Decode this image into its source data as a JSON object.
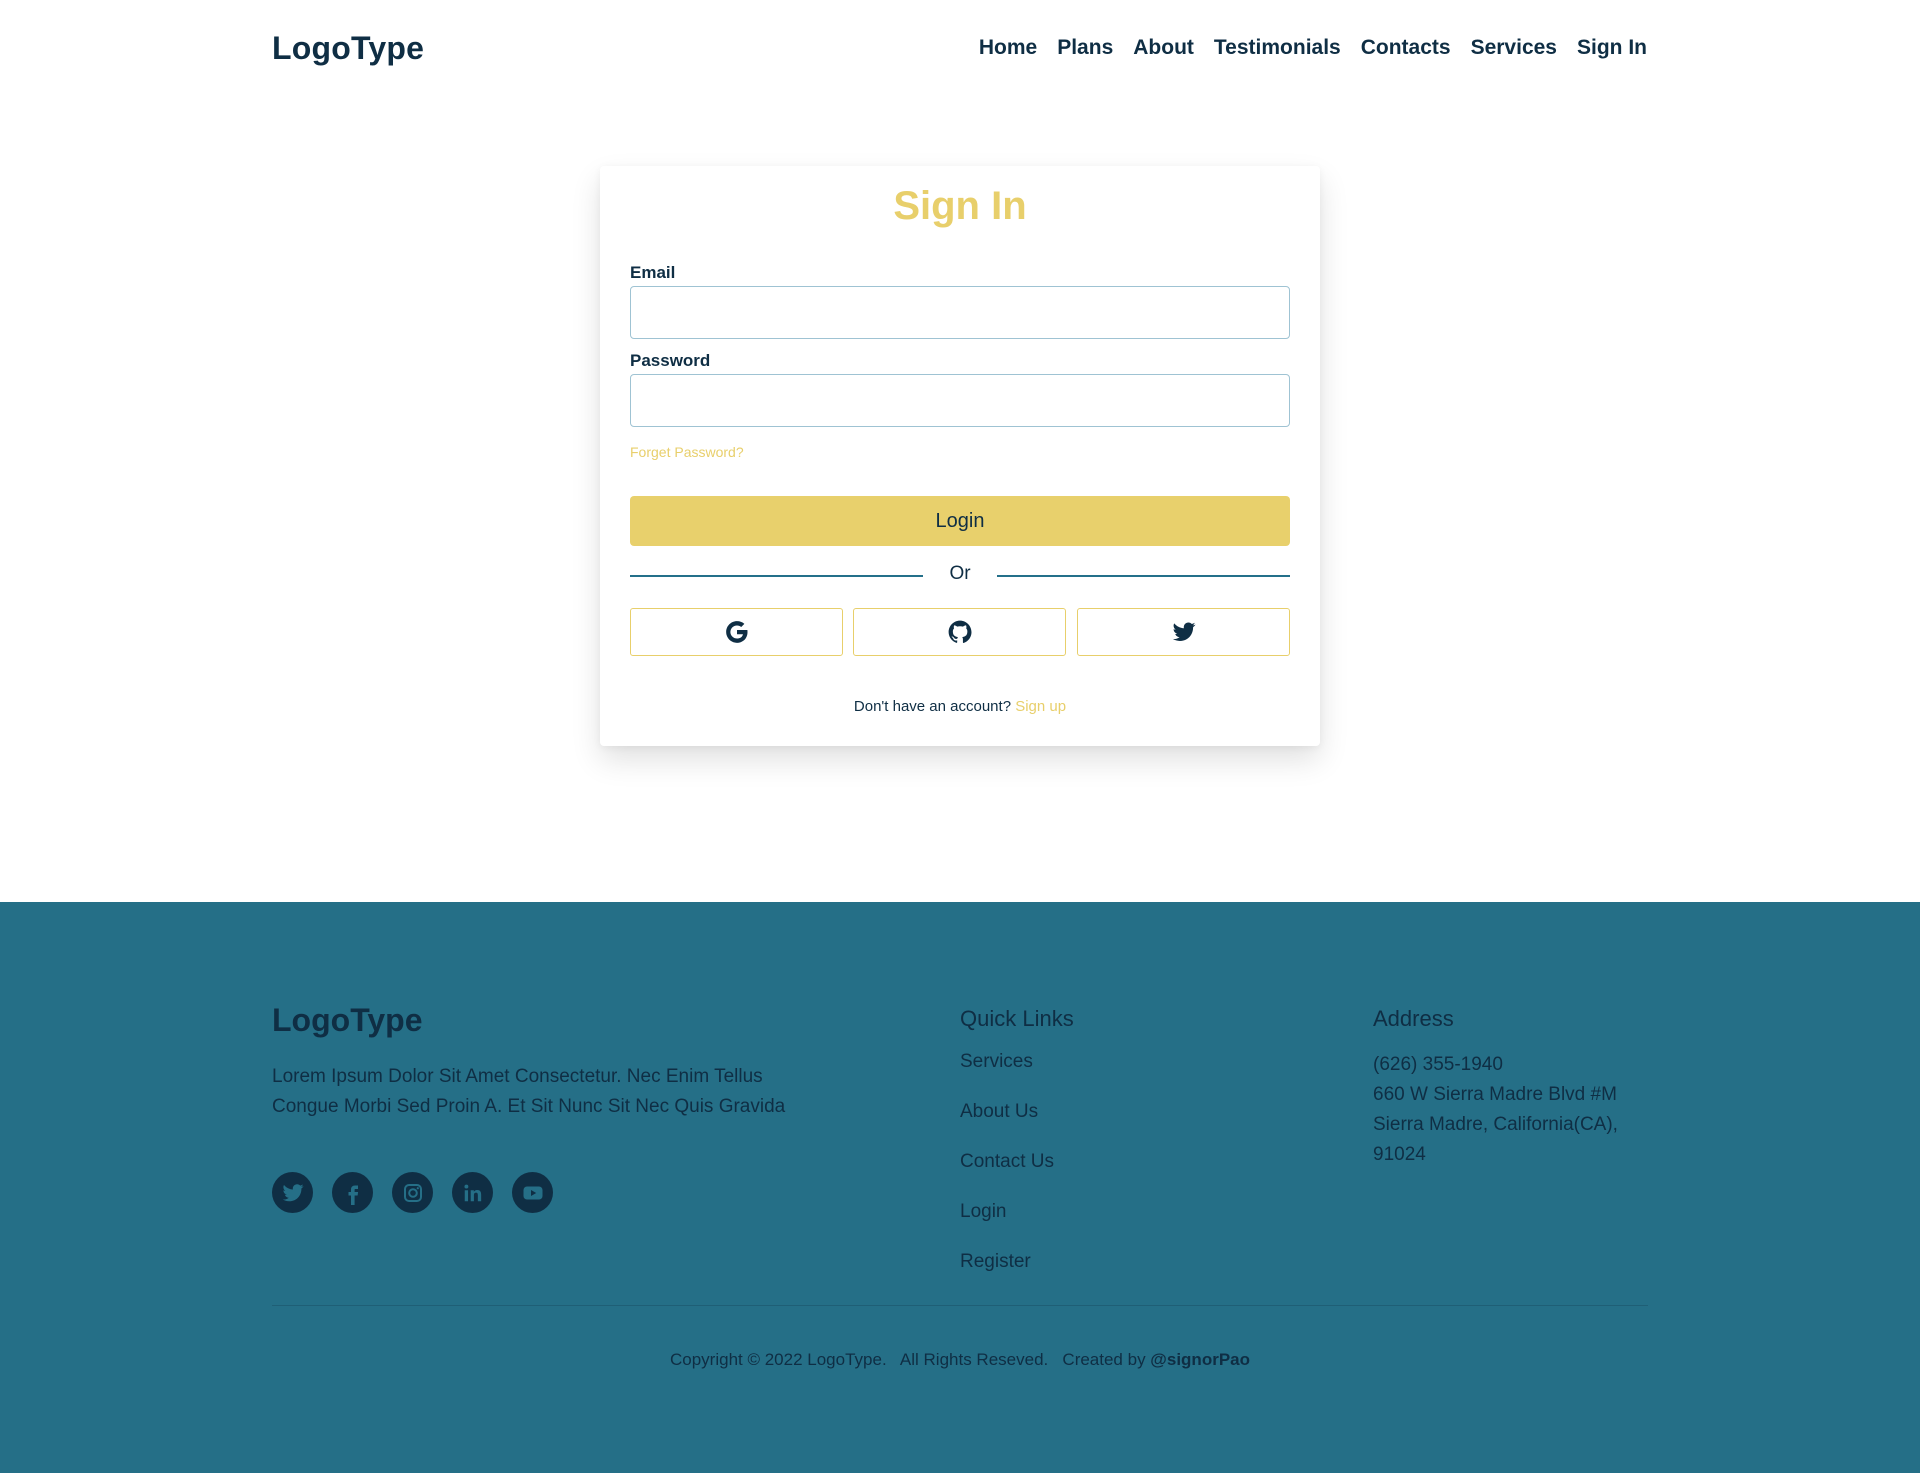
{
  "header": {
    "logo": "LogoType",
    "nav": [
      "Home",
      "Plans",
      "About",
      "Testimonials",
      "Contacts",
      "Services",
      "Sign In"
    ]
  },
  "signin": {
    "title": "Sign In",
    "email_label": "Email",
    "email_value": "",
    "password_label": "Password",
    "password_value": "",
    "forget_link": "Forget Password?",
    "login_button": "Login",
    "or_text": "Or",
    "social_buttons": [
      "google-icon",
      "github-icon",
      "twitter-icon"
    ],
    "no_account_text": "Don't have an account?",
    "signup_link": "Sign up"
  },
  "footer": {
    "logo": "LogoType",
    "description": "Lorem Ipsum Dolor Sit Amet Consectetur. Nec Enim Tellus Congue Morbi Sed Proin A. Et Sit Nunc Sit Nec Quis Gravida",
    "social_icons": [
      "twitter-icon",
      "facebook-icon",
      "instagram-icon",
      "linkedin-icon",
      "youtube-icon"
    ],
    "quick_links_heading": "Quick Links",
    "quick_links": [
      "Services",
      "About Us",
      "Contact Us",
      "Login",
      "Register"
    ],
    "address_heading": "Address",
    "address_lines": [
      "(626) 355-1940",
      "660 W Sierra Madre Blvd #M",
      "Sierra Madre, California(CA),",
      "91024"
    ],
    "copyright": "Copyright © 2022 LogoType.   All Rights Reseved.   Created by ",
    "creator": "@signorPao"
  },
  "colors": {
    "navy": "#0f2e44",
    "gold": "#e8cf6b",
    "teal": "#256f87"
  }
}
